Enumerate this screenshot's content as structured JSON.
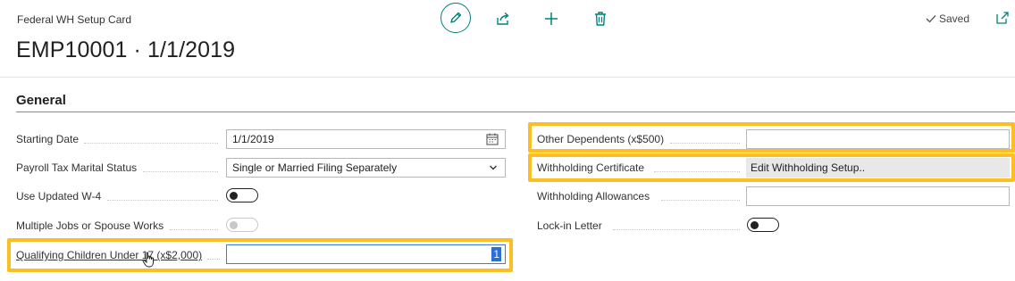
{
  "header": {
    "card_label": "Federal WH Setup Card",
    "title": "EMP10001 · 1/1/2019",
    "saved_label": "Saved"
  },
  "toolbar": {
    "icons": [
      "edit-icon",
      "share-icon",
      "add-icon",
      "delete-icon",
      "popout-icon"
    ]
  },
  "colors": {
    "accent": "#00827a",
    "highlight": "#fbbf24",
    "selection": "#2b6fd6"
  },
  "section": {
    "title": "General"
  },
  "left_fields": {
    "starting_date": {
      "label": "Starting Date",
      "value": "1/1/2019"
    },
    "marital_status": {
      "label": "Payroll Tax Marital Status",
      "value": "Single or Married Filing Separately"
    },
    "updated_w4": {
      "label": "Use Updated W-4",
      "value": "on"
    },
    "multiple_jobs": {
      "label": "Multiple Jobs or Spouse Works",
      "value": "off"
    },
    "qualifying_children": {
      "label": "Qualifying Children Under 17 (x$2,000)",
      "value": "1"
    }
  },
  "right_fields": {
    "other_dependents": {
      "label": "Other Dependents (x$500)",
      "value": ""
    },
    "withholding_certificate": {
      "label": "Withholding Certificate",
      "value": "Edit Withholding Setup.."
    },
    "withholding_allowances": {
      "label": "Withholding Allowances",
      "value": ""
    },
    "lockin_letter": {
      "label": "Lock-in Letter",
      "value": "on"
    }
  }
}
